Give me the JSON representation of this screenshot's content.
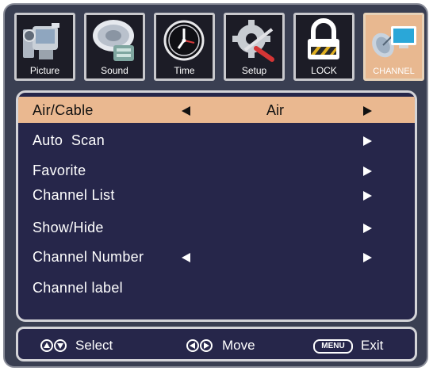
{
  "tabs": [
    {
      "label": "Picture",
      "icon": "camera-icon"
    },
    {
      "label": "Sound",
      "icon": "speaker-icon"
    },
    {
      "label": "Time",
      "icon": "clock-icon"
    },
    {
      "label": "Setup",
      "icon": "gear-tools-icon"
    },
    {
      "label": "LOCK",
      "icon": "padlock-icon"
    },
    {
      "label": "CHANNEL",
      "icon": "satellite-dish-icon"
    }
  ],
  "active_tab": "CHANNEL",
  "menu": {
    "items": [
      {
        "label": "Air/Cable",
        "value": "Air"
      },
      {
        "label": "Auto  Scan"
      },
      {
        "label": "Favorite"
      },
      {
        "label": "Channel List"
      },
      {
        "label": "Show/Hide"
      },
      {
        "label": "Channel Number"
      },
      {
        "label": "Channel label"
      }
    ],
    "selected_index": 0
  },
  "footer": {
    "select_label": "Select",
    "move_label": "Move",
    "menu_key": "MENU",
    "exit_label": "Exit"
  },
  "colors": {
    "frame": "#3a3f52",
    "panel": "#26264a",
    "highlight": "#eab890",
    "tab_background": "#1c1c26",
    "active_tab_background": "#e8b890"
  }
}
